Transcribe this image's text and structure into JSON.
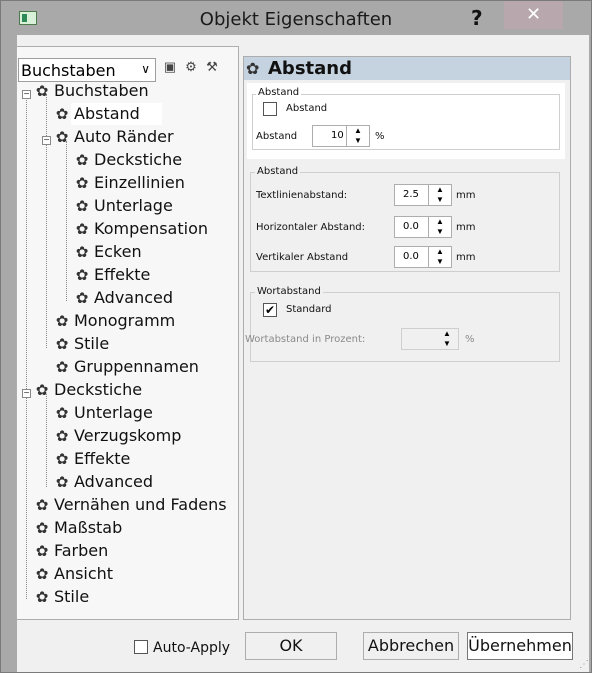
{
  "window": {
    "title": "Objekt Eigenschaften",
    "help_label": "?",
    "close_label": "✕"
  },
  "tree": {
    "combo_value": "Buchstaben",
    "items": [
      {
        "label": "Buchstaben"
      },
      {
        "label": "Abstand"
      },
      {
        "label": "Auto Ränder"
      },
      {
        "label": "Deckstiche"
      },
      {
        "label": "Einzellinien"
      },
      {
        "label": "Unterlage"
      },
      {
        "label": "Kompensation"
      },
      {
        "label": "Ecken"
      },
      {
        "label": "Effekte"
      },
      {
        "label": "Advanced"
      },
      {
        "label": "Monogramm"
      },
      {
        "label": "Stile"
      },
      {
        "label": "Gruppennamen"
      },
      {
        "label": "Deckstiche"
      },
      {
        "label": "Unterlage"
      },
      {
        "label": "Verzugskomp"
      },
      {
        "label": "Effekte"
      },
      {
        "label": "Advanced"
      },
      {
        "label": "Vernähen und Fadens"
      },
      {
        "label": "Maßstab"
      },
      {
        "label": "Farben"
      },
      {
        "label": "Ansicht"
      },
      {
        "label": "Stile"
      }
    ]
  },
  "panel": {
    "header": "Abstand",
    "group1": {
      "title": "Abstand",
      "checkbox_label": "Abstand",
      "field_label": "Abstand",
      "field_value": "10",
      "unit": "%"
    },
    "group2": {
      "title": "Abstand",
      "rows": [
        {
          "label": "Textlinienabstand:",
          "value": "2.5",
          "unit": "mm"
        },
        {
          "label": "Horizontaler Abstand:",
          "value": "0.0",
          "unit": "mm"
        },
        {
          "label": "Vertikaler Abstand",
          "value": "0.0",
          "unit": "mm"
        }
      ]
    },
    "group3": {
      "title": "Wortabstand",
      "checkbox_label": "Standard",
      "field_label": "Wortabstand in Prozent:",
      "field_value": "",
      "unit": "%"
    }
  },
  "buttons": {
    "auto_apply": "Auto-Apply",
    "ok": "OK",
    "cancel": "Abbrechen",
    "apply": "Übernehmen"
  }
}
